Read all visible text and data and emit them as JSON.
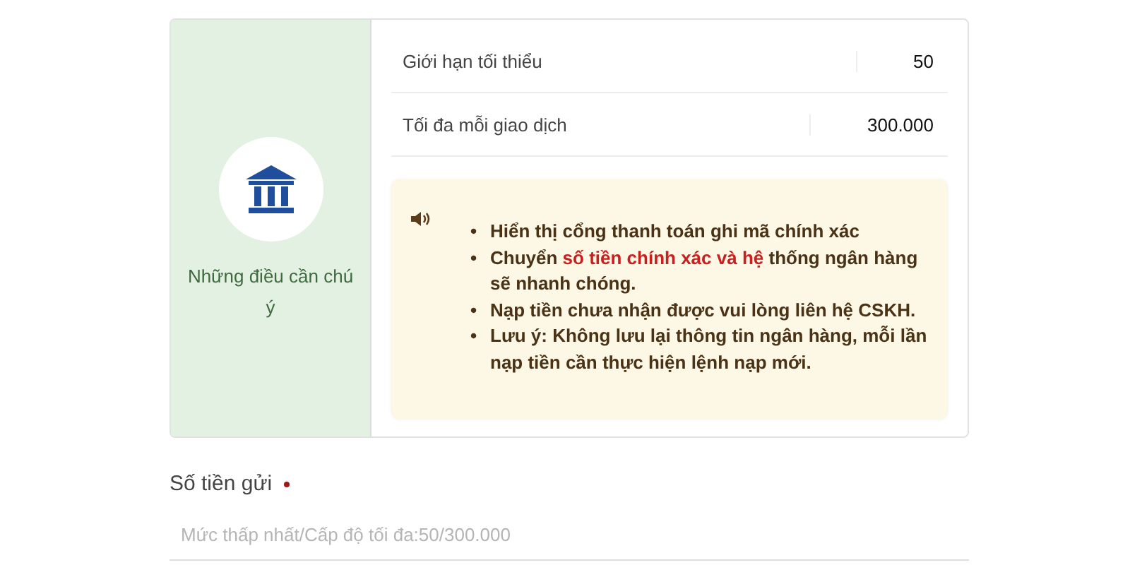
{
  "side_panel": {
    "label": "Những điều cần chú ý"
  },
  "limits": [
    {
      "label": "Giới hạn tối thiểu",
      "value": "50"
    },
    {
      "label": "Tối đa mỗi giao dịch",
      "value": "300.000"
    }
  ],
  "notice": {
    "items": [
      {
        "marker": "•",
        "parts": [
          {
            "text": "Hiển thị cổng thanh toán ghi mã chính xác",
            "highlight": false
          }
        ]
      },
      {
        "marker": "•",
        "parts": [
          {
            "text": "Chuyển ",
            "highlight": false
          },
          {
            "text": "số tiền chính xác và hệ",
            "highlight": true
          },
          {
            "text": " thống ngân hàng sẽ nhanh chóng.",
            "highlight": false
          }
        ]
      },
      {
        "marker": "•",
        "parts": [
          {
            "text": "Nạp tiền chưa nhận được vui lòng liên hệ CSKH.",
            "highlight": false
          }
        ]
      },
      {
        "marker": "•",
        "parts": [
          {
            "text": "Lưu ý: Không lưu lại thông tin ngân hàng, mỗi lần nạp tiền cần thực hiện lệnh nạp mới.",
            "highlight": false
          }
        ]
      }
    ]
  },
  "deposit": {
    "label": "Số tiền gửi",
    "required": true,
    "placeholder": "Mức thấp nhất/Cấp độ tối đa:50/300.000"
  }
}
